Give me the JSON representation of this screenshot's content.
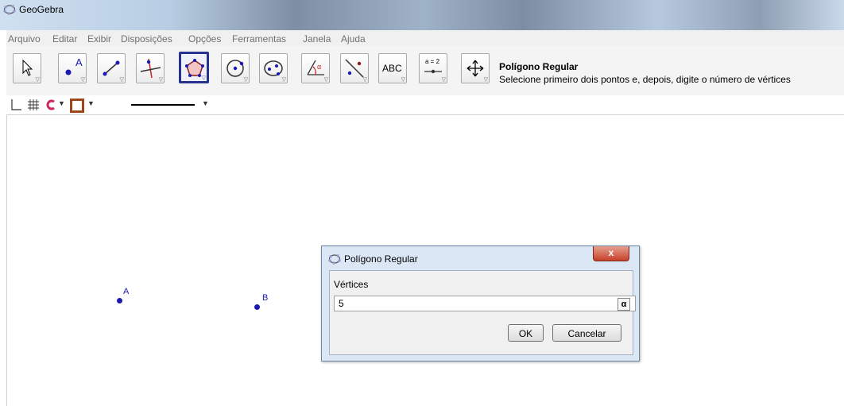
{
  "window": {
    "title": "GeoGebra"
  },
  "menu": [
    "Arquivo",
    "Editar",
    "Exibir",
    "Disposições",
    "Opções",
    "Ferramentas",
    "Janela",
    "Ajuda"
  ],
  "toolbar": {
    "tools": [
      "move-tool-icon",
      "point-tool-icon",
      "line-tool-icon",
      "perpendicular-line-tool-icon",
      "regular-polygon-tool-icon",
      "circle-tool-icon",
      "conic-tool-icon",
      "angle-tool-icon",
      "reflect-tool-icon",
      "text-tool-icon",
      "slider-tool-icon",
      "move-graphics-view-tool-icon"
    ],
    "point_label": "A",
    "text_tool_label": "ABC",
    "slider_label": "a = 2",
    "active_tool_title": "Polígono Regular",
    "active_tool_description": "Selecione primeiro dois pontos e, depois, digite o número de vértices"
  },
  "graphics": {
    "points": [
      {
        "label": "A"
      },
      {
        "label": "B"
      }
    ]
  },
  "dialog": {
    "title": "Polígono Regular",
    "close_label": "x",
    "field_label": "Vértices",
    "field_value": "5",
    "alpha_label": "α",
    "ok_label": "OK",
    "cancel_label": "Cancelar"
  },
  "colors": {
    "point": "#1a1ab0",
    "active_tool_border": "#25338f",
    "close_button": "#c6402a"
  }
}
